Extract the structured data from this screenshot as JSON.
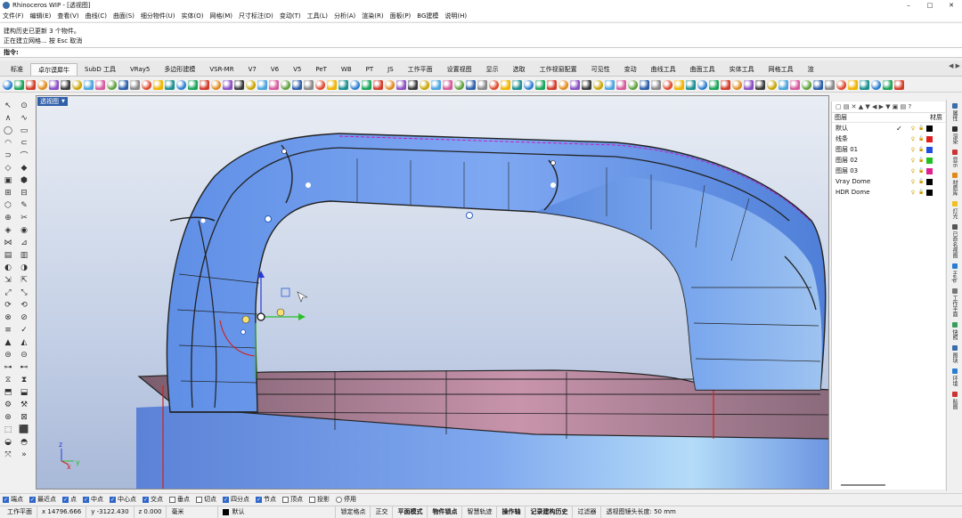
{
  "window": {
    "title": "Rhinoceros WIP - [透视图]",
    "minimize": "–",
    "maximize": "□",
    "close": "✕"
  },
  "menu": [
    "文件(F)",
    "编辑(E)",
    "查看(V)",
    "曲线(C)",
    "曲面(S)",
    "细分物件(U)",
    "实体(O)",
    "网格(M)",
    "尺寸标注(D)",
    "变动(T)",
    "工具(L)",
    "分析(A)",
    "渲染(R)",
    "面板(P)",
    "BG建模",
    "说明(H)"
  ],
  "command_history": [
    "建构历史已更新 3 个物件。",
    "正在建立网格... 按 Esc 取消"
  ],
  "command_prompt": "指令:",
  "tabs": [
    "标准",
    "卓尔谟犀牛",
    "SubD 工具",
    "VRay5",
    "多边形建模",
    "VSR-MR",
    "V7",
    "V6",
    "V5",
    "PeT",
    "WB",
    "PT",
    "JS",
    "工作平面",
    "设置视图",
    "显示",
    "选取",
    "工作视窗配置",
    "可见性",
    "变动",
    "曲线工具",
    "曲面工具",
    "实体工具",
    "网格工具",
    "渲"
  ],
  "active_tab": "卓尔谟犀牛",
  "tab_nav": "◀ ▶",
  "icon_colors": [
    "#2a7dd1",
    "#1aa35a",
    "#d13c2a",
    "#e08a1a",
    "#8a4fc4",
    "#3a3a3a",
    "#c9a400",
    "#4aa3df",
    "#d65a9c",
    "#5d9f3a",
    "#2d5fa8",
    "#888888",
    "#e0462a",
    "#f0b400",
    "#1b8f8f"
  ],
  "left_tools": [
    "↖",
    "⊙",
    "∧",
    "∿",
    "◯",
    "▭",
    "◠",
    "⊂",
    "⊃",
    "⌒",
    "◇",
    "◆",
    "▣",
    "⬢",
    "⊞",
    "⊟",
    "⬡",
    "✎",
    "⊕",
    "✂",
    "◈",
    "◉",
    "⋈",
    "⊿",
    "▤",
    "▥",
    "◐",
    "◑",
    "⇲",
    "⇱",
    "⤢",
    "⤡",
    "⟳",
    "⟲",
    "⊗",
    "⊘",
    "≡",
    "✓",
    "▲",
    "◭",
    "⊜",
    "⊝",
    "⊶",
    "⊷",
    "⧖",
    "⧗",
    "⬒",
    "⬓",
    "⚙",
    "⚒",
    "⊛",
    "⊠",
    "⬚",
    "⬛",
    "◒",
    "◓",
    "⤧",
    "»"
  ],
  "viewport": {
    "label": "透视图",
    "label_arrow": "▼",
    "axis": {
      "x": "x",
      "y": "y",
      "z": "z"
    }
  },
  "layers": {
    "toolbar": "▢ ▤ ✕ ▲ ▼ ◀ ▶ ▼ ▣ ▤ ?",
    "header_name": "图层",
    "header_material": "材质",
    "rows": [
      {
        "name": "默认",
        "color": "#000000",
        "current": "✓"
      },
      {
        "name": "线条",
        "color": "#e02020",
        "current": ""
      },
      {
        "name": "图层 01",
        "color": "#2050e0",
        "current": ""
      },
      {
        "name": "图层 02",
        "color": "#20c020",
        "current": ""
      },
      {
        "name": "图层 03",
        "color": "#e02090",
        "current": ""
      },
      {
        "name": "Vray Dome",
        "color": "#000000",
        "current": ""
      },
      {
        "name": "HDR Dome",
        "color": "#000000",
        "current": ""
      }
    ]
  },
  "right_panels": [
    {
      "label": "属性",
      "color": "#3a6da8"
    },
    {
      "label": "渲染",
      "color": "#2a2a2a"
    },
    {
      "label": "显示",
      "color": "#c33"
    },
    {
      "label": "材质库",
      "color": "#e08a1a"
    },
    {
      "label": "灯光",
      "color": "#f0c020"
    },
    {
      "label": "已命名视图",
      "color": "#555"
    },
    {
      "label": "Help",
      "color": "#2a7dd1"
    },
    {
      "label": "工作平面",
      "color": "#777"
    },
    {
      "label": "快照",
      "color": "#3a9d5a"
    },
    {
      "label": "图块",
      "color": "#3a6da8"
    },
    {
      "label": "环境",
      "color": "#2a7dd1"
    },
    {
      "label": "贴图",
      "color": "#c33"
    }
  ],
  "osnaps": [
    {
      "label": "端点",
      "on": true
    },
    {
      "label": "最近点",
      "on": true
    },
    {
      "label": "点",
      "on": true
    },
    {
      "label": "中点",
      "on": true
    },
    {
      "label": "中心点",
      "on": true
    },
    {
      "label": "交点",
      "on": true
    },
    {
      "label": "垂点",
      "on": false
    },
    {
      "label": "切点",
      "on": false
    },
    {
      "label": "四分点",
      "on": true
    },
    {
      "label": "节点",
      "on": true
    },
    {
      "label": "顶点",
      "on": false
    }
  ],
  "osnap_project": "投影",
  "osnap_disable": "停用",
  "status": {
    "cplane": "工作平面",
    "x": "x 14796.666",
    "y": "y -3122.430",
    "z": "z 0.000",
    "units": "毫米",
    "layer": "默认",
    "grid_snap": "锁定格点",
    "ortho": "正交",
    "planar": "平面模式",
    "osnap": "物件锁点",
    "smarttrack": "智慧轨迹",
    "gumball": "操作轴",
    "history": "记录建构历史",
    "filter": "过滤器",
    "lens": "透视图镜头长度: 50 mm"
  }
}
